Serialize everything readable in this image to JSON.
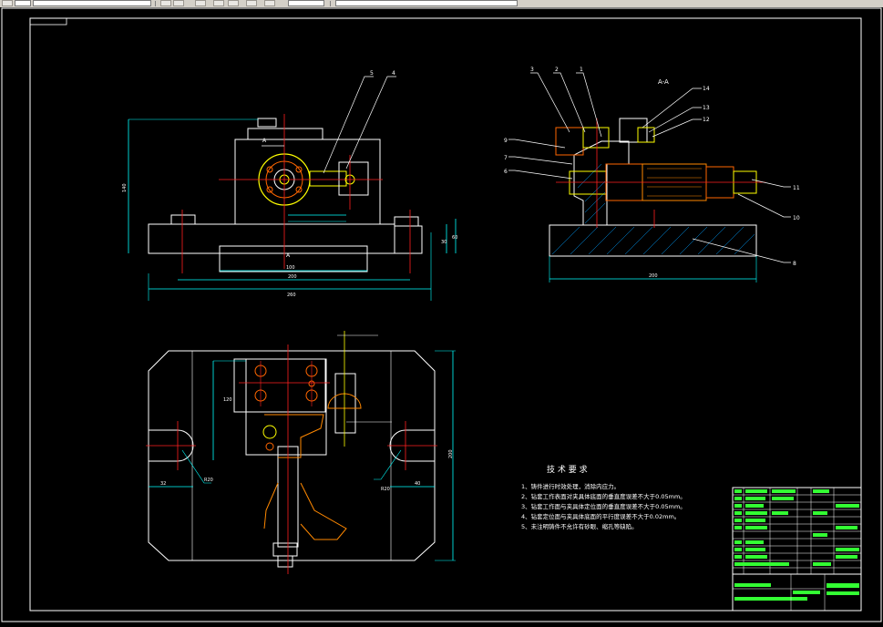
{
  "toolbar": {
    "buttons": [
      "file-icon",
      "open-icon",
      "save-icon",
      "print-icon",
      "undo-icon",
      "redo-icon",
      "zoom-icon",
      "pan-icon"
    ]
  },
  "drawing": {
    "section_label": "A-A",
    "view_marker": "A",
    "tech_title": "技 术 要 求",
    "tech_lines": [
      "1、铸件进行时效处理，消除内应力。",
      "2、钻套工作表面对夹具体底面的垂直度误差不大于0.05mm。",
      "3、钻套工作面与夹具体定位面的垂直度误差不大于0.05mm。",
      "4、钻套定位面与夹具体底面的平行度误差不大于0.02mm。",
      "5、未注明铸件不允许有砂眼、缩孔等缺陷。"
    ],
    "dims": {
      "front_width": "260",
      "front_base": "200",
      "front_inner": "100",
      "front_height": "140",
      "front_right1": "30",
      "front_right2": "60",
      "section_width": "200",
      "plan_height": "200",
      "plan_r_left": "R20",
      "plan_r_right": "R20",
      "plan_left": "32",
      "plan_right": "40",
      "plan_dim": "120"
    },
    "callouts_front": [
      "5",
      "4"
    ],
    "callouts_section": [
      "3",
      "2",
      "1",
      "14",
      "13",
      "12",
      "9",
      "7",
      "6",
      "11",
      "10",
      "8"
    ]
  }
}
